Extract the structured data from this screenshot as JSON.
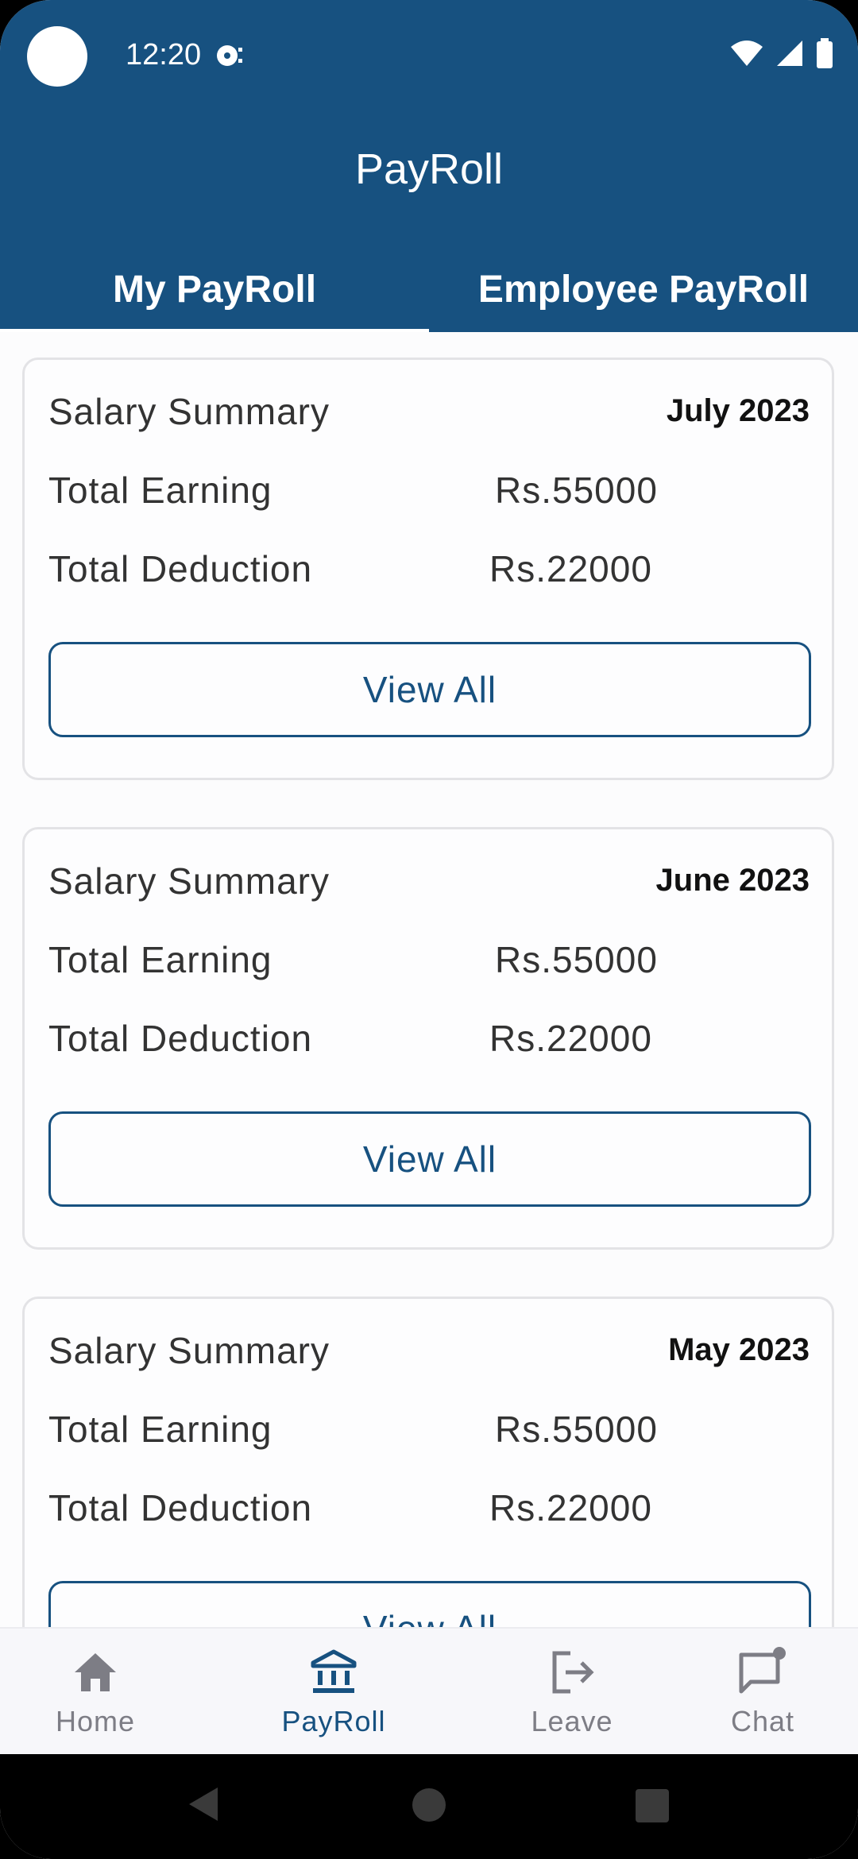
{
  "status_bar": {
    "time": "12:20"
  },
  "header": {
    "title": "PayRoll",
    "tabs": [
      {
        "label": "My PayRoll",
        "active": true
      },
      {
        "label": "Employee PayRoll",
        "active": false
      }
    ]
  },
  "cards": [
    {
      "title": "Salary Summary",
      "month": "July 2023",
      "earning_label": "Total Earning",
      "earning_value": "Rs.55000",
      "deduction_label": "Total Deduction",
      "deduction_value": "Rs.22000",
      "button_label": "View All"
    },
    {
      "title": "Salary Summary",
      "month": "June 2023",
      "earning_label": "Total Earning",
      "earning_value": "Rs.55000",
      "deduction_label": "Total Deduction",
      "deduction_value": "Rs.22000",
      "button_label": "View All"
    },
    {
      "title": "Salary Summary",
      "month": "May 2023",
      "earning_label": "Total Earning",
      "earning_value": "Rs.55000",
      "deduction_label": "Total Deduction",
      "deduction_value": "Rs.22000",
      "button_label": "View All"
    }
  ],
  "bottom_nav": [
    {
      "label": "Home",
      "icon": "home-icon",
      "active": false
    },
    {
      "label": "PayRoll",
      "icon": "bank-icon",
      "active": true
    },
    {
      "label": "Leave",
      "icon": "exit-icon",
      "active": false
    },
    {
      "label": "Chat",
      "icon": "chat-icon",
      "active": false
    }
  ],
  "colors": {
    "primary": "#175180",
    "inactive": "#7d7d85",
    "card_border": "#e3e3e6"
  }
}
